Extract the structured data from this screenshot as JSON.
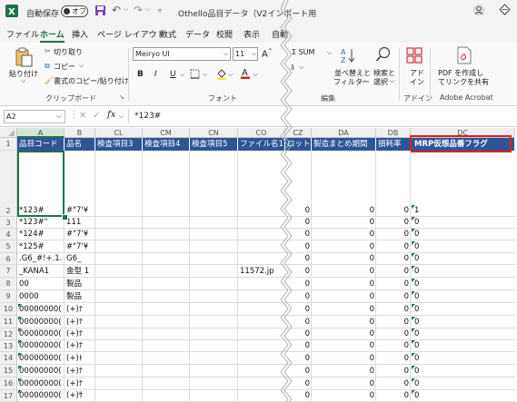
{
  "titlebar": {
    "autosave_label": "自動保存",
    "autosave_state": "オフ",
    "file_title": "Othello品目データ（V2インポート用"
  },
  "menu": [
    "ファイル",
    "ホーム",
    "挿入",
    "ページ レイアウト",
    "数式",
    "データ",
    "校閲",
    "表示",
    "自動"
  ],
  "ribbon": {
    "clipboard": {
      "paste": "貼り付け",
      "cut": "切り取り",
      "copy": "コピー",
      "format_painter": "書式のコピー/貼り付け",
      "group": "クリップボード"
    },
    "font": {
      "name": "Meiryo UI",
      "size": "11",
      "group": "フォント"
    },
    "editing": {
      "autosum": "Σ SUM",
      "sort_filter": "並べ替えと",
      "sort_filter2": "フィルター",
      "find_select": "検索と",
      "find_select2": "選択",
      "group": "編集"
    },
    "addins": {
      "label": "アド",
      "label2": "イン",
      "group": "アドイン"
    },
    "acrobat": {
      "label": "PDF を作成し",
      "label2": "てリンクを共有",
      "group": "Adobe Acrobat"
    }
  },
  "formula_bar": {
    "name_box": "A2",
    "fx": "fx",
    "content": "*123#"
  },
  "columns": [
    "A",
    "B",
    "CL",
    "CM",
    "CN",
    "CO",
    "CZ",
    "DA",
    "DB",
    "DC"
  ],
  "headers": [
    "品目コード",
    "品名",
    "検査項目3",
    "検査項目4",
    "検査項目5",
    "ファイル名1",
    "ロット",
    "製造まとめ期間",
    "損耗率",
    "MRP仮想品番フラグ"
  ],
  "row_numbers": [
    "1",
    "2",
    "3",
    "4",
    "5",
    "6",
    "7",
    "8",
    "9",
    "10",
    "11",
    "12",
    "13",
    "14",
    "15",
    "16",
    "17"
  ],
  "rows": [
    {
      "a": "*123#",
      "b": "#\"7'¥",
      "co": "",
      "cz": "0",
      "da": "0",
      "db": "0",
      "dc": "1"
    },
    {
      "a": "*123#\"",
      "b": "111",
      "co": "",
      "cz": "0",
      "da": "0",
      "db": "0",
      "dc": "0"
    },
    {
      "a": "*124#",
      "b": "#\"7'¥",
      "co": "",
      "cz": "0",
      "da": "0",
      "db": "0",
      "dc": "0"
    },
    {
      "a": "*125#",
      "b": "#\"7'¥",
      "co": "",
      "cz": "0",
      "da": "0",
      "db": "0",
      "dc": "0"
    },
    {
      "a": ".G6_#!+.1.",
      "b": "G6_",
      "co": "",
      "cz": "0",
      "da": "0",
      "db": "0",
      "dc": "0"
    },
    {
      "a": "_KANA1",
      "b": "金型 1",
      "co": "11572.jp",
      "cz": "0",
      "da": "0",
      "db": "0",
      "dc": "0"
    },
    {
      "a": "00",
      "b": "製品",
      "co": "",
      "cz": "0",
      "da": "0",
      "db": "0",
      "dc": "0"
    },
    {
      "a": "0000",
      "b": "製品",
      "co": "",
      "cz": "0",
      "da": "0",
      "db": "0",
      "dc": "0"
    },
    {
      "a": "00000000(",
      "b": "(+)ﾅ",
      "co": "",
      "cz": "0",
      "da": "0",
      "db": "0",
      "dc": "0"
    },
    {
      "a": "00000000(",
      "b": "(+)ﾅ",
      "co": "",
      "cz": "0",
      "da": "0",
      "db": "0",
      "dc": "0"
    },
    {
      "a": "00000000(",
      "b": "(+)ﾅ",
      "co": "",
      "cz": "0",
      "da": "0",
      "db": "0",
      "dc": "0"
    },
    {
      "a": "00000000(",
      "b": "(+)ﾅ",
      "co": "",
      "cz": "0",
      "da": "0",
      "db": "0",
      "dc": "0"
    },
    {
      "a": "00000000(",
      "b": "(+)ﾄ",
      "co": "",
      "cz": "0",
      "da": "0",
      "db": "0",
      "dc": "0"
    },
    {
      "a": "00000000(",
      "b": "(+)ﾅ",
      "co": "",
      "cz": "0",
      "da": "0",
      "db": "0",
      "dc": "0"
    },
    {
      "a": "00000000(",
      "b": "(+)ﾅ",
      "co": "",
      "cz": "0",
      "da": "0",
      "db": "0",
      "dc": "0"
    },
    {
      "a": "00000000(",
      "b": "(+)ｻ",
      "co": "",
      "cz": "0",
      "da": "0",
      "db": "0",
      "dc": "0"
    }
  ],
  "colors": {
    "header_fill": "#2f5597",
    "highlight_border": "#e0201b",
    "excel_green": "#217346"
  }
}
